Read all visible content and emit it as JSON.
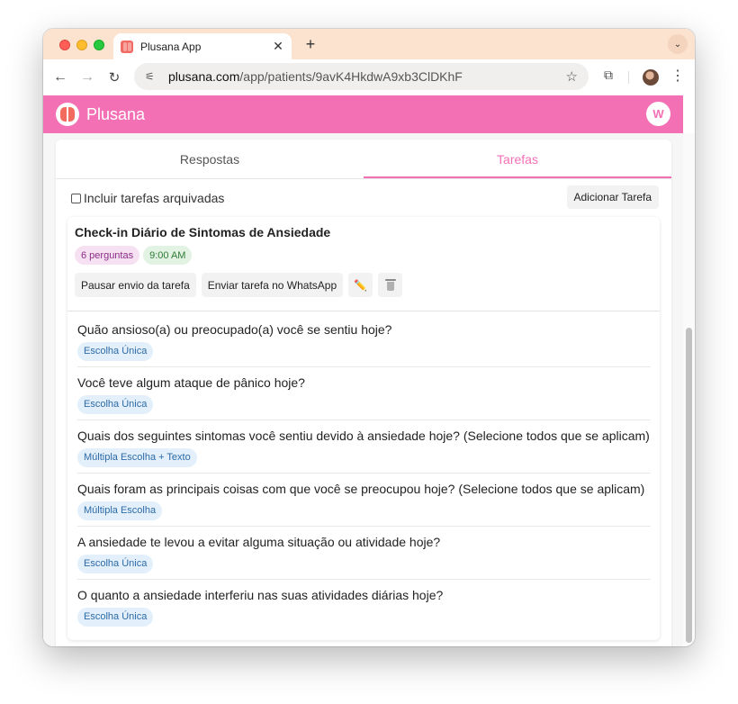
{
  "browser": {
    "tab_title": "Plusana App",
    "tab_close": "✕",
    "new_tab": "+",
    "tab_menu": "⌄",
    "url_host": "plusana.com",
    "url_path": "/app/patients/9avK4HkdwA9xb3ClDKhF"
  },
  "header": {
    "brand": "Plusana",
    "avatar_initial": "W",
    "color": "#f470b5"
  },
  "tabs": [
    {
      "label": "Respostas",
      "active": false
    },
    {
      "label": "Tarefas",
      "active": true
    }
  ],
  "archived_checkbox": {
    "label": "Incluir tarefas arquivadas",
    "checked": false
  },
  "add_task_label": "Adicionar Tarefa",
  "task": {
    "title": "Check-in Diário de Sintomas de Ansiedade",
    "question_count": "6 perguntas",
    "time": "9:00 AM",
    "pause_label": "Pausar envio da tarefa",
    "whatsapp_label": "Enviar tarefa no WhatsApp",
    "questions": [
      {
        "text": "Quão ansioso(a) ou preocupado(a) você se sentiu hoje?",
        "type": "Escolha Única"
      },
      {
        "text": "Você teve algum ataque de pânico hoje?",
        "type": "Escolha Única"
      },
      {
        "text": "Quais dos seguintes sintomas você sentiu devido à ansiedade hoje? (Selecione todos que se aplicam)",
        "type": "Múltipla Escolha + Texto"
      },
      {
        "text": "Quais foram as principais coisas com que você se preocupou hoje? (Selecione todos que se aplicam)",
        "type": "Múltipla Escolha"
      },
      {
        "text": "A ansiedade te levou a evitar alguma situação ou atividade hoje?",
        "type": "Escolha Única"
      },
      {
        "text": "O quanto a ansiedade interferiu nas suas atividades diárias hoje?",
        "type": "Escolha Única"
      }
    ]
  }
}
